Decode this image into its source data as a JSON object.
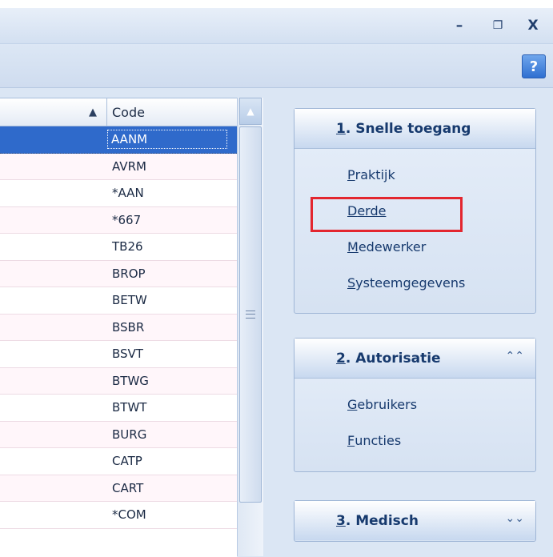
{
  "window": {
    "minimize": "–",
    "restore": "❐",
    "close": "X"
  },
  "toolbar": {
    "help": "?"
  },
  "grid": {
    "sort_indicator": "▲",
    "column_header": "Code",
    "rows": [
      "AANM",
      "AVRM",
      "*AAN",
      "*667",
      "TB26",
      "BROP",
      "BETW",
      "BSBR",
      "BSVT",
      "BTWG",
      "BTWT",
      "BURG",
      "CATP",
      "CART",
      "*COM"
    ],
    "selected_index": 0
  },
  "panels": [
    {
      "number": "1",
      "title": ". Snelle toegang",
      "chevron": "",
      "items": [
        {
          "first": "P",
          "rest": "raktijk"
        },
        {
          "first": "D",
          "rest": "erde"
        },
        {
          "first": "M",
          "rest": "edewerker"
        },
        {
          "first": "S",
          "rest": "ysteemgegevens"
        }
      ]
    },
    {
      "number": "2",
      "title": ". Autorisatie",
      "chevron": "⌃⌃",
      "items": [
        {
          "first": "G",
          "rest": "ebruikers"
        },
        {
          "first": "F",
          "rest": "uncties"
        }
      ]
    },
    {
      "number": "3",
      "title": ". Medisch",
      "chevron": "⌄⌄",
      "items": []
    }
  ]
}
